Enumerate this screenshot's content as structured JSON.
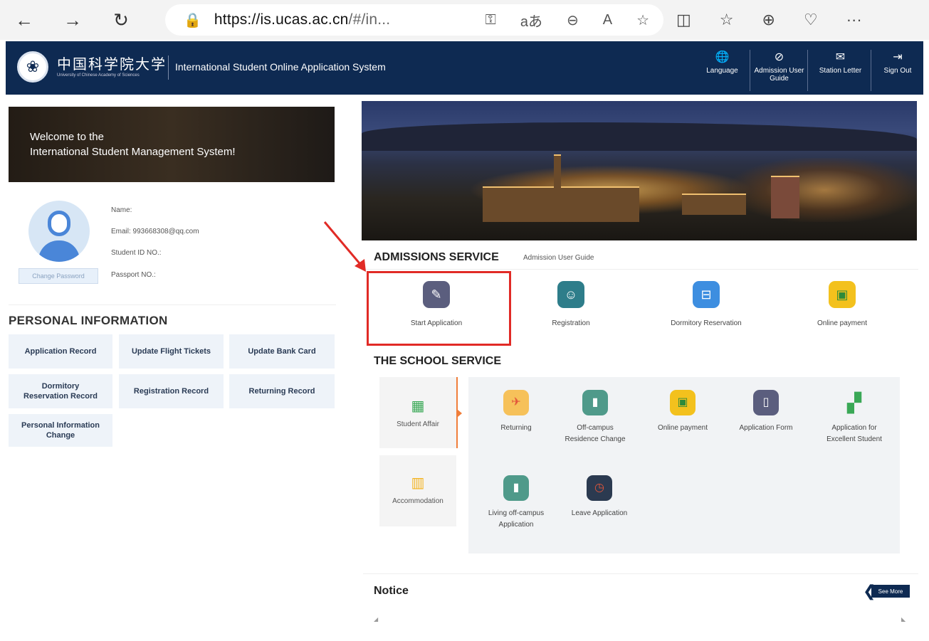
{
  "browser": {
    "back_icon": "←",
    "forward_icon": "→",
    "refresh_icon": "↻",
    "url_host": "https://is.ucas.ac.cn",
    "url_rest": "/#/in...",
    "more_icon": "···"
  },
  "header": {
    "logo_text": "中国科学院大学",
    "logo_subtitle": "University of Chinese Academy of Sciences",
    "system_title": "International Student Online Application System",
    "buttons": [
      {
        "icon": "🌐",
        "label": "Language"
      },
      {
        "icon": "⊘",
        "label": "Admission User Guide"
      },
      {
        "icon": "✉",
        "label": "Station Letter"
      },
      {
        "icon": "⇥",
        "label": "Sign Out"
      }
    ]
  },
  "welcome": {
    "line1": "Welcome to the",
    "line2": "International Student Management System!"
  },
  "profile": {
    "change_password": "Change Password",
    "name": "Name:",
    "email": "Email:  993668308@qq.com",
    "student_id": "Student ID NO.:",
    "passport": "Passport NO.:"
  },
  "personal_info": {
    "title": "PERSONAL INFORMATION",
    "buttons": [
      "Application Record",
      "Update Flight Tickets",
      "Update Bank Card",
      "Dormitory Reservation Record",
      "Registration Record",
      "Returning Record",
      "Personal Information Change"
    ]
  },
  "admissions": {
    "title": "ADMISSIONS SERVICE",
    "guide_link": "Admission User Guide",
    "items": [
      {
        "label": "Start Application",
        "color": "#5b5e7e",
        "icon": "✎"
      },
      {
        "label": "Registration",
        "color": "#2e7d8a",
        "icon": "☺"
      },
      {
        "label": "Dormitory Reservation",
        "color": "#3d8ee0",
        "icon": "⊟"
      },
      {
        "label": "Online payment",
        "color": "#f3c11d",
        "icon": "▣"
      }
    ]
  },
  "school_service": {
    "title": "THE SCHOOL SERVICE",
    "categories": [
      {
        "label": "Student Affair",
        "icon": "▦"
      },
      {
        "label": "Accommodation",
        "icon": "▥"
      }
    ],
    "items": [
      {
        "label": "Returning",
        "color": "#f6c15a",
        "icon": "✈"
      },
      {
        "label": "Off-campus Residence Change",
        "color": "#4f9a8a",
        "icon": "▮"
      },
      {
        "label": "Online payment",
        "color": "#f3c11d",
        "icon": "▣"
      },
      {
        "label": "Application Form",
        "color": "#5b5e7e",
        "icon": "▯"
      },
      {
        "label": "Application for Excellent Student",
        "color": "#ffffff",
        "icon": "▞"
      },
      {
        "label": "Living off-campus Application",
        "color": "#4f9a8a",
        "icon": "▮"
      },
      {
        "label": "Leave Application",
        "color": "#2b3a50",
        "icon": "◷"
      }
    ]
  },
  "notice": {
    "title": "Notice",
    "see_more": "See More"
  }
}
